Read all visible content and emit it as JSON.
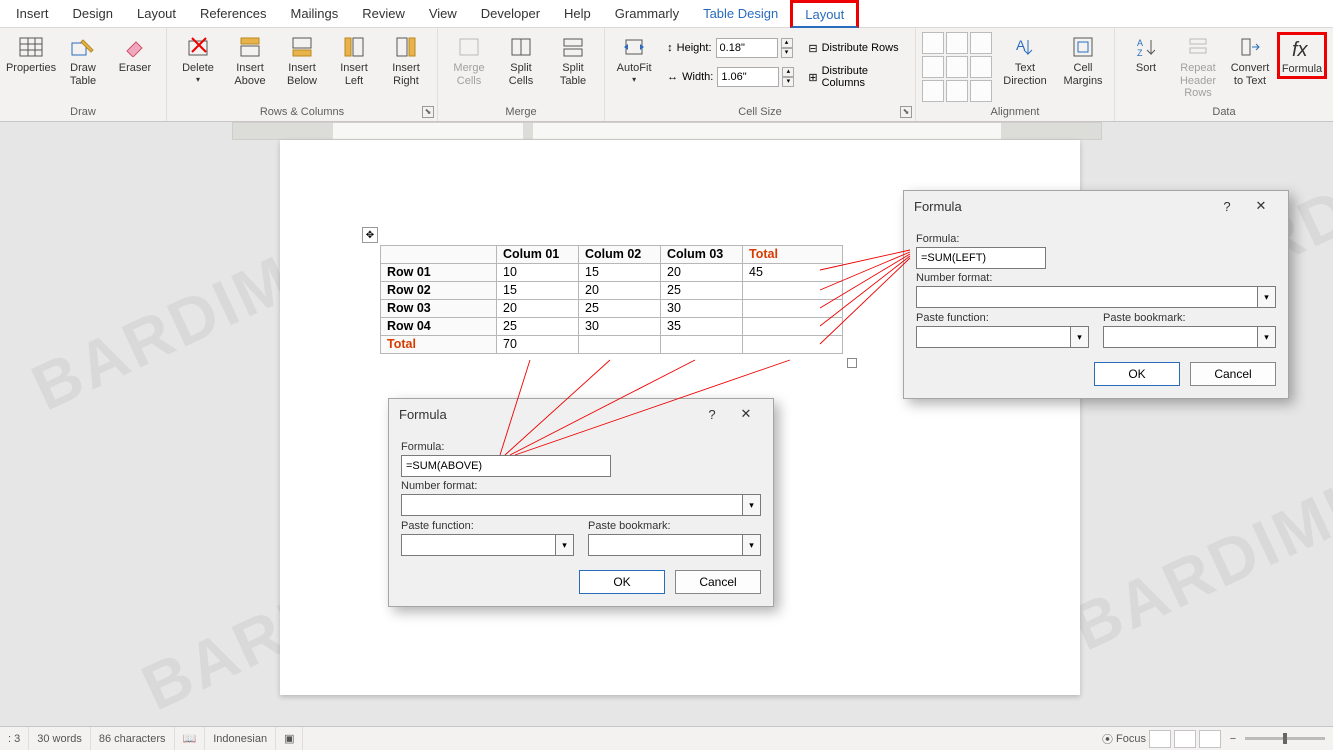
{
  "tabs": [
    "Insert",
    "Design",
    "Layout",
    "References",
    "Mailings",
    "Review",
    "View",
    "Developer",
    "Help",
    "Grammarly"
  ],
  "contextual_tabs": [
    "Table Design",
    "Layout"
  ],
  "active_tab": "Layout",
  "ribbon": {
    "draw": {
      "label": "Draw",
      "props": "Properties",
      "draw": "Draw Table",
      "eraser": "Eraser"
    },
    "rows_cols": {
      "label": "Rows & Columns",
      "delete": "Delete",
      "above": "Insert Above",
      "below": "Insert Below",
      "left": "Insert Left",
      "right": "Insert Right"
    },
    "merge": {
      "label": "Merge",
      "merge": "Merge Cells",
      "splitc": "Split Cells",
      "splitt": "Split Table"
    },
    "cellsize": {
      "label": "Cell Size",
      "autofit": "AutoFit",
      "height_label": "Height:",
      "height": "0.18\"",
      "width_label": "Width:",
      "width": "1.06\"",
      "dist_rows": "Distribute Rows",
      "dist_cols": "Distribute Columns"
    },
    "alignment": {
      "label": "Alignment",
      "text_dir": "Text Direction",
      "cell_marg": "Cell Margins"
    },
    "data": {
      "label": "Data",
      "sort": "Sort",
      "repeat": "Repeat Header Rows",
      "convert": "Convert to Text",
      "formula": "Formula"
    }
  },
  "table": {
    "headers": [
      "",
      "Colum 01",
      "Colum 02",
      "Colum 03",
      "Total"
    ],
    "rows": [
      [
        "Row 01",
        "10",
        "15",
        "20",
        "45"
      ],
      [
        "Row 02",
        "15",
        "20",
        "25",
        ""
      ],
      [
        "Row 03",
        "20",
        "25",
        "30",
        ""
      ],
      [
        "Row 04",
        "25",
        "30",
        "35",
        ""
      ]
    ],
    "total_row": [
      "Total",
      "70",
      "",
      "",
      ""
    ]
  },
  "dialog_labels": {
    "title": "Formula",
    "formula": "Formula:",
    "number_format": "Number format:",
    "paste_function": "Paste function:",
    "paste_bookmark": "Paste bookmark:",
    "ok": "OK",
    "cancel": "Cancel"
  },
  "dlg_left": {
    "formula": "=SUM(LEFT)"
  },
  "dlg_above": {
    "formula": "=SUM(ABOVE)"
  },
  "status": {
    "page": ": 3",
    "words": "30 words",
    "chars": "86 characters",
    "lang": "Indonesian",
    "focus": "Focus"
  },
  "watermark": "BARDIMIN"
}
